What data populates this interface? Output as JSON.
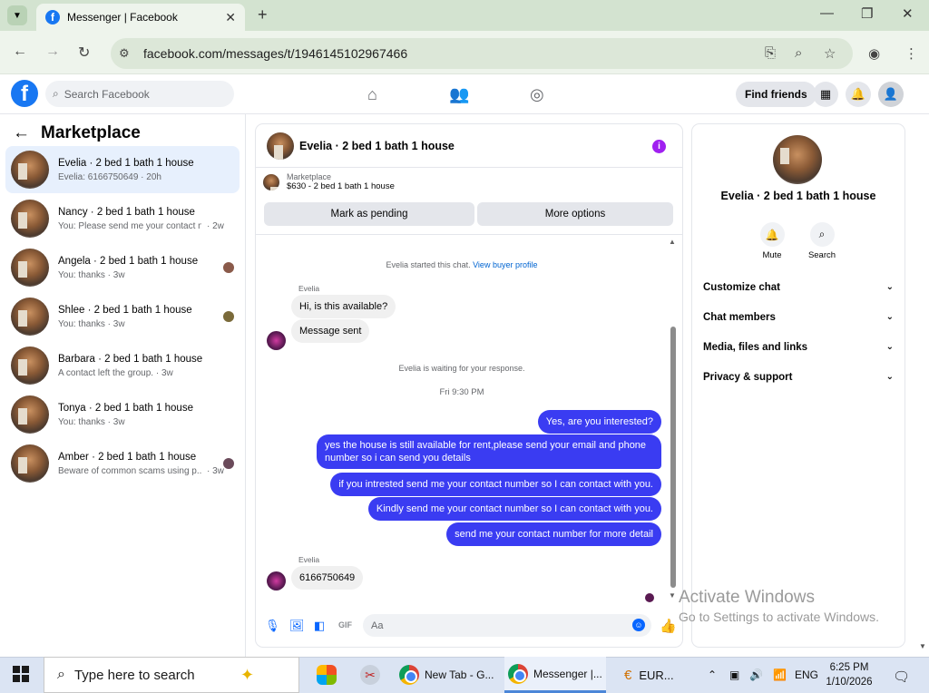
{
  "browser": {
    "tab_title": "Messenger | Facebook",
    "url": "facebook.com/messages/t/1946145102967466"
  },
  "fb": {
    "search_placeholder": "Search Facebook",
    "find_friends": "Find friends"
  },
  "sidebar": {
    "title": "Marketplace",
    "conversations": [
      {
        "name": "Evelia · 2 bed 1 bath 1 house",
        "preview": "Evelia: 6166750649 · 20h"
      },
      {
        "name": "Nancy · 2 bed 1 bath 1 house",
        "preview": "You: Please send me your contact nu...",
        "time": "· 2w"
      },
      {
        "name": "Angela · 2 bed 1 bath 1 house",
        "preview": "You: thanks · 3w"
      },
      {
        "name": "Shlee · 2 bed 1 bath 1 house",
        "preview": "You: thanks · 3w"
      },
      {
        "name": "Barbara · 2 bed 1 bath 1 house",
        "preview": "A contact left the group. · 3w"
      },
      {
        "name": "Tonya · 2 bed 1 bath 1 house",
        "preview": "You: thanks · 3w"
      },
      {
        "name": "Amber · 2 bed 1 bath 1 house",
        "preview": "Beware of common scams using p...",
        "time": "· 3w"
      }
    ]
  },
  "chat": {
    "title": "Evelia · 2 bed 1 bath 1 house",
    "marketplace_label": "Marketplace",
    "listing": "$630 - 2 bed 1 bath 1 house",
    "mark_pending": "Mark as pending",
    "more_options": "More options",
    "started": "Evelia started this chat.",
    "view_profile": "View buyer profile",
    "sender": "Evelia",
    "in1": "Hi, is this available?",
    "in2": "Message sent",
    "waiting": "Evelia is waiting for your response.",
    "timestamp": "Fri 9:30 PM",
    "out1": "Yes, are you interested?",
    "out2": "yes the house is still available for rent,please send your email and phone number so i can send you details",
    "out3": "if you intrested send me your contact number so I can contact with you.",
    "out4": "Kindly send me your contact number so I can contact with you.",
    "out5": "send me your contact number for more detail",
    "in3": "6166750649",
    "composer_placeholder": "Aa"
  },
  "details": {
    "name": "Evelia · 2 bed 1 bath 1 house",
    "mute": "Mute",
    "search": "Search",
    "items": [
      "Customize chat",
      "Chat members",
      "Media, files and links",
      "Privacy & support"
    ]
  },
  "watermark": {
    "line1": "Activate Windows",
    "line2": "Go to Settings to activate Windows."
  },
  "taskbar": {
    "search": "Type here to search",
    "item1": "New Tab - G...",
    "item2": "Messenger |...",
    "item3": "EUR...",
    "lang": "ENG",
    "time": "6:25 PM",
    "date": "1/10/2026"
  }
}
